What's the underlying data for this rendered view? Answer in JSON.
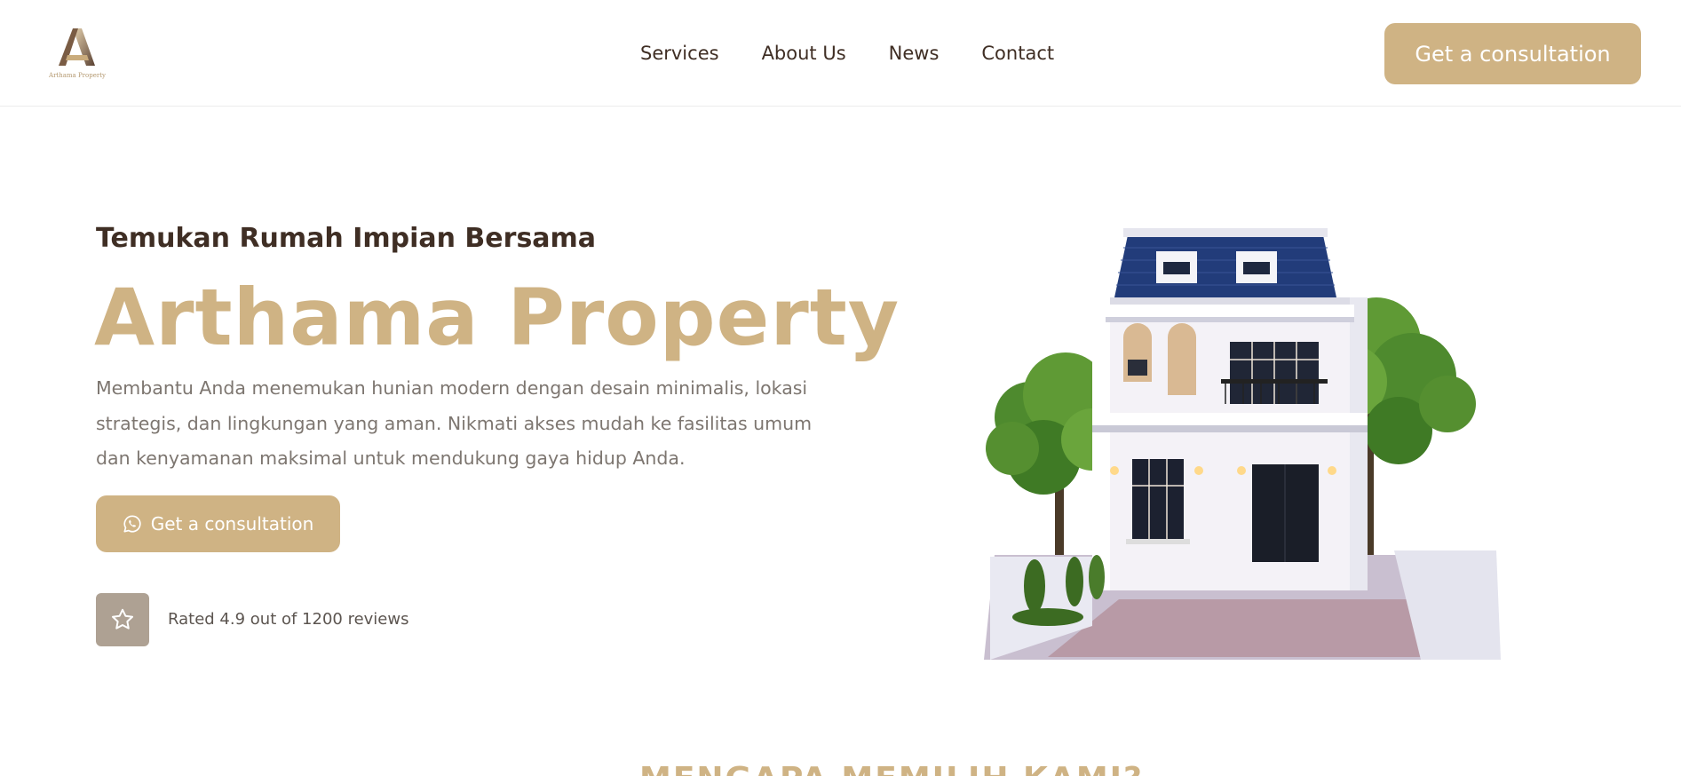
{
  "brand": {
    "logo_text": "Arthama Property",
    "accent_color": "#cfb384",
    "text_color": "#3f2e24"
  },
  "nav": {
    "items": [
      "Services",
      "About Us",
      "News",
      "Contact"
    ]
  },
  "header": {
    "cta_label": "Get a consultation"
  },
  "hero": {
    "subtitle": "Temukan Rumah Impian Bersama",
    "title": "Arthama Property",
    "description": "Membantu Anda menemukan hunian modern dengan desain minimalis, lokasi strategis, dan lingkungan yang aman. Nikmati akses mudah ke fasilitas umum dan kenyamanan maksimal untuk mendukung gaya hidup Anda.",
    "cta_label": "Get a consultation",
    "cta_icon": "whatsapp-icon",
    "rating_icon": "star-icon",
    "rating_text": "Rated 4.9 out of 1200 reviews"
  },
  "next_section": {
    "heading": "MENGAPA MEMILIH KAMI?"
  }
}
